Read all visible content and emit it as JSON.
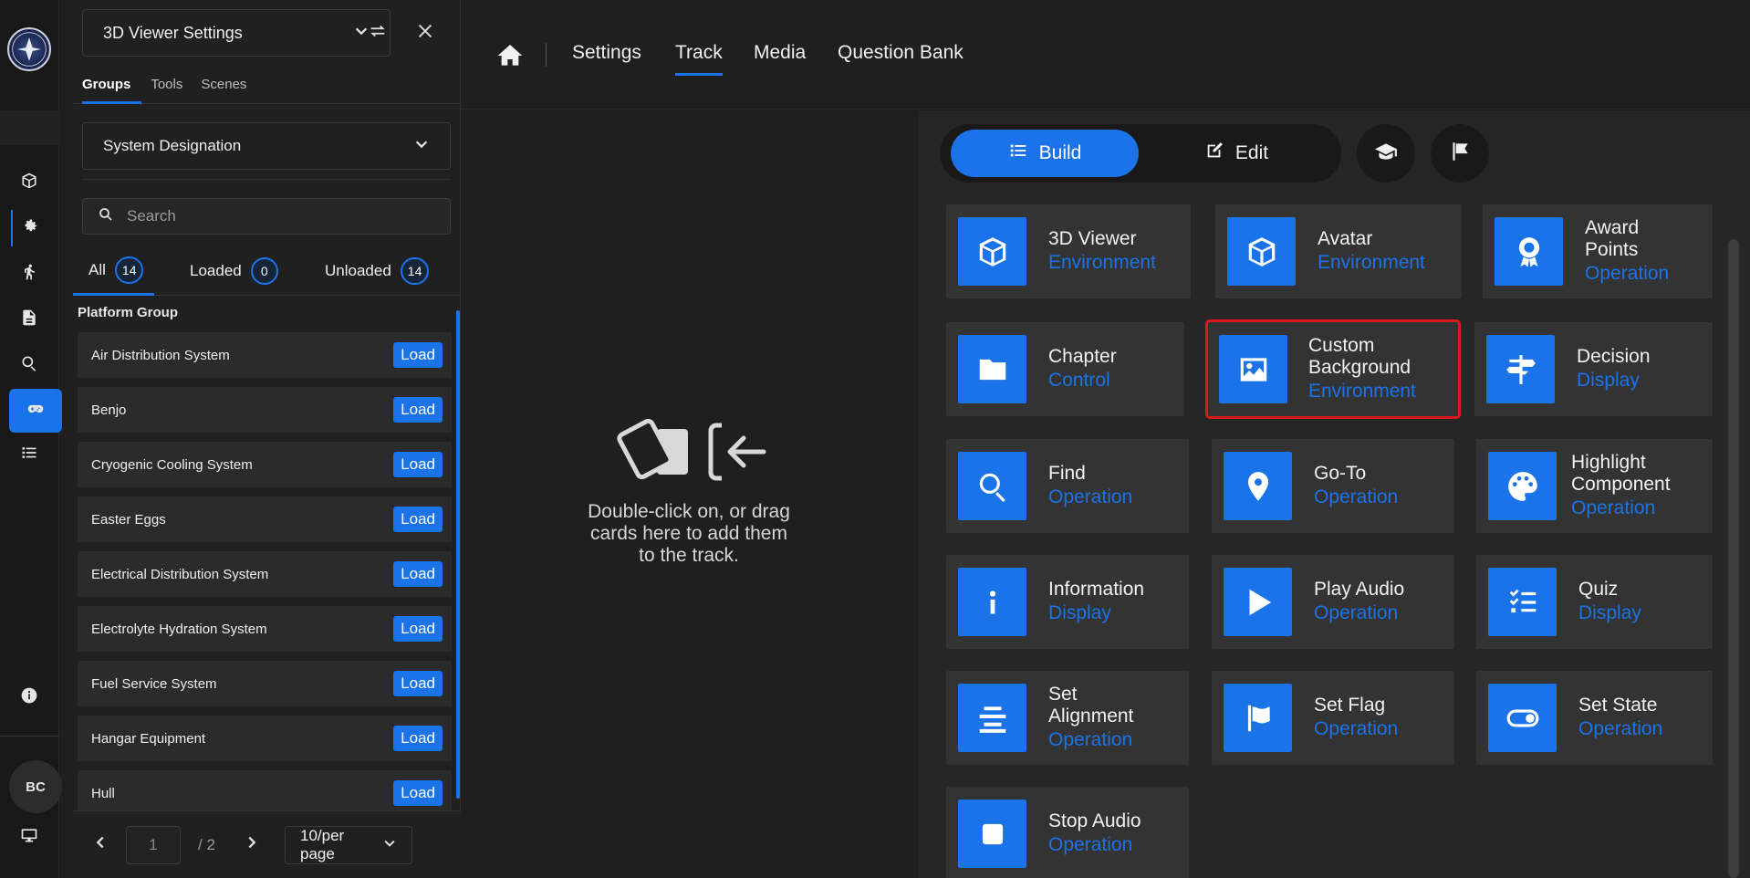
{
  "panel": {
    "title": "3D Viewer Settings",
    "tabs": [
      {
        "label": "Groups"
      },
      {
        "label": "Tools"
      },
      {
        "label": "Scenes"
      }
    ],
    "dropdown": "System Designation",
    "search_placeholder": "Search",
    "filters": [
      {
        "label": "All",
        "count": "14"
      },
      {
        "label": "Loaded",
        "count": "0"
      },
      {
        "label": "Unloaded",
        "count": "14"
      }
    ],
    "group_title": "Platform Group",
    "load_label": "Load",
    "items": [
      {
        "name": "Air Distribution System"
      },
      {
        "name": "Benjo"
      },
      {
        "name": "Cryogenic Cooling System"
      },
      {
        "name": "Easter Eggs"
      },
      {
        "name": "Electrical Distribution System"
      },
      {
        "name": "Electrolyte Hydration System"
      },
      {
        "name": "Fuel Service System"
      },
      {
        "name": "Hangar Equipment"
      },
      {
        "name": "Hull"
      }
    ],
    "pager": {
      "current": "1",
      "total": "/ 2",
      "per_page": "10/per page"
    }
  },
  "rail": {
    "avatar": "BC"
  },
  "nav": {
    "items": [
      {
        "label": "Settings"
      },
      {
        "label": "Track"
      },
      {
        "label": "Media"
      },
      {
        "label": "Question Bank"
      }
    ],
    "active": "Track"
  },
  "track": {
    "hint_line1": "Double-click on, or drag",
    "hint_line2": "cards here to add them",
    "hint_line3": "to the track."
  },
  "library": {
    "modes": [
      {
        "label": "Build"
      },
      {
        "label": "Edit"
      }
    ],
    "active_mode": "Build",
    "cards": [
      {
        "name": "3D Viewer",
        "type": "Environment",
        "icon": "cube-icon"
      },
      {
        "name": "Avatar",
        "type": "Environment",
        "icon": "cube-icon"
      },
      {
        "name": "Award Points",
        "type": "Operation",
        "icon": "award-icon"
      },
      {
        "name": "Chapter",
        "type": "Control",
        "icon": "folder-icon"
      },
      {
        "name": "Custom Background",
        "type": "Environment",
        "icon": "image-icon"
      },
      {
        "name": "Decision",
        "type": "Display",
        "icon": "signpost-icon"
      },
      {
        "name": "Find",
        "type": "Operation",
        "icon": "search-icon"
      },
      {
        "name": "Go-To",
        "type": "Operation",
        "icon": "map-pin-icon"
      },
      {
        "name": "Highlight Component",
        "type": "Operation",
        "icon": "palette-icon"
      },
      {
        "name": "Information",
        "type": "Display",
        "icon": "info-icon"
      },
      {
        "name": "Play Audio",
        "type": "Operation",
        "icon": "play-icon"
      },
      {
        "name": "Quiz",
        "type": "Display",
        "icon": "checklist-icon"
      },
      {
        "name": "Set Alignment",
        "type": "Operation",
        "icon": "align-center-icon"
      },
      {
        "name": "Set Flag",
        "type": "Operation",
        "icon": "flag-icon"
      },
      {
        "name": "Set State",
        "type": "Operation",
        "icon": "toggle-icon"
      },
      {
        "name": "Stop Audio",
        "type": "Operation",
        "icon": "stop-icon"
      }
    ],
    "selected_card": "Custom Background"
  },
  "colors": {
    "accent": "#1a73e8",
    "selection": "#d9191c",
    "background": "#1f1f1f",
    "card": "#333333"
  }
}
